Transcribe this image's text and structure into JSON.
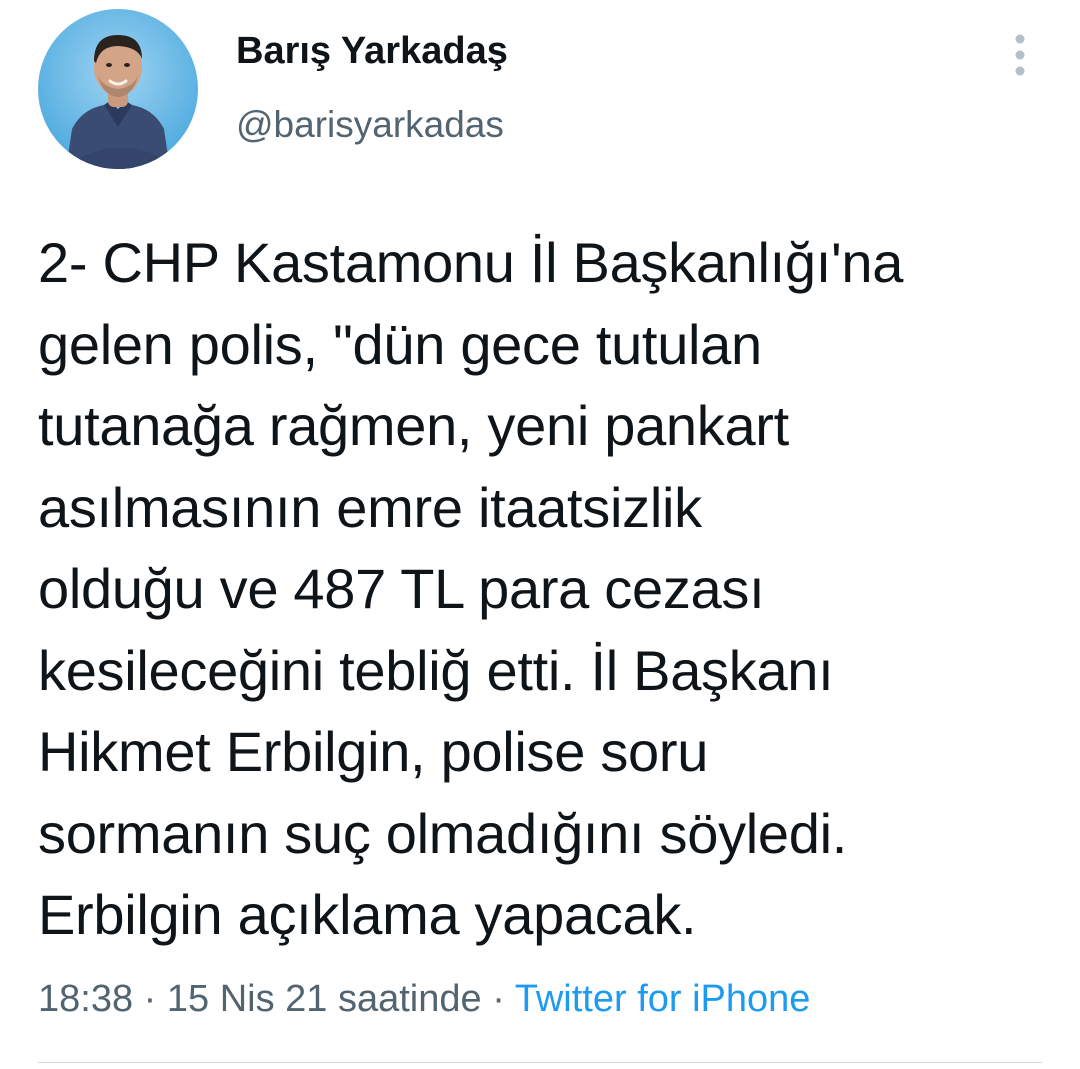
{
  "author": {
    "display_name": "Barış Yarkadaş",
    "handle": "@barisyarkadas",
    "avatar_icon": "profile-photo"
  },
  "tweet": {
    "text": "2- CHP Kastamonu İl Başkanlığı'na\ngelen polis, \"dün gece tutulan\ntutanağa rağmen, yeni pankart\nasılmasının emre itaatsizlik\nolduğu ve 487 TL para cezası\nkesileceğini tebliğ etti. İl Başkanı\nHikmet Erbilgin, polise soru\nsormanın suç olmadığını söyledi.\nErbilgin açıklama yapacak."
  },
  "meta": {
    "time": "18:38",
    "separator": " · ",
    "date": "15 Nis 21 saatinde",
    "source": "Twitter for iPhone"
  },
  "colors": {
    "text": "#0f1419",
    "secondary": "#536471",
    "link": "#1d9bf0",
    "divider": "#cfd9de"
  },
  "icons": {
    "more": "more-vertical-icon"
  }
}
